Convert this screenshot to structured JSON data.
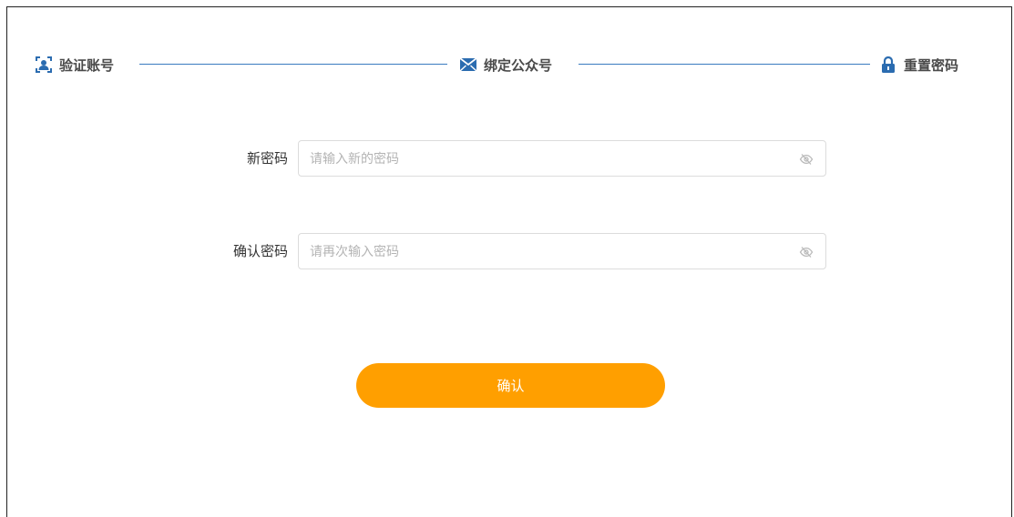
{
  "steps": [
    {
      "label": "验证账号",
      "icon": "user-scan-icon"
    },
    {
      "label": "绑定公众号",
      "icon": "envelope-icon"
    },
    {
      "label": "重置密码",
      "icon": "lock-icon"
    }
  ],
  "colors": {
    "accent": "#ff9f00",
    "step_line": "#3a7bbf",
    "step_icon": "#2b6cb0"
  },
  "form": {
    "new_password": {
      "label": "新密码",
      "placeholder": "请输入新的密码",
      "value": ""
    },
    "confirm_password": {
      "label": "确认密码",
      "placeholder": "请再次输入密码",
      "value": ""
    }
  },
  "submit_label": "确认"
}
